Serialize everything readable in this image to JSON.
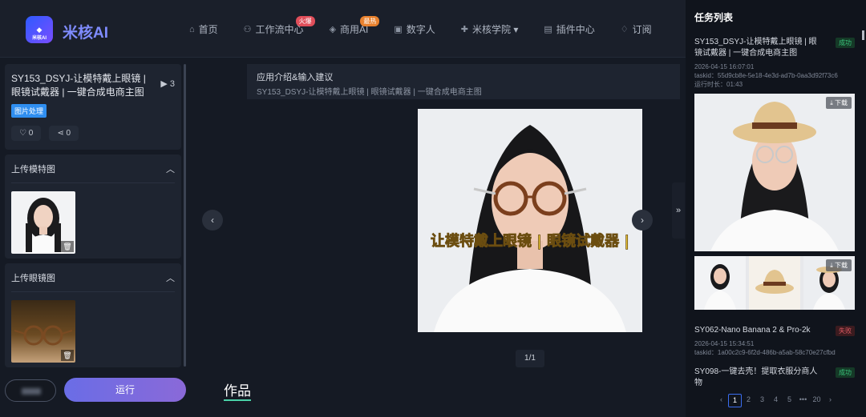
{
  "app": {
    "name": "米核AI",
    "logo_sub": "米核AI"
  },
  "nav": {
    "items": [
      {
        "icon": "home-icon",
        "glyph": "⌂",
        "label": "首页"
      },
      {
        "icon": "workflow-icon",
        "glyph": "⚇",
        "label": "工作流中心",
        "badge": "火爆"
      },
      {
        "icon": "commercial-icon",
        "glyph": "◈",
        "label": "商用AI",
        "badge": "最热"
      },
      {
        "icon": "digital-human-icon",
        "glyph": "▣",
        "label": "数字人"
      },
      {
        "icon": "academy-icon",
        "glyph": "✚",
        "label": "米核学院 ▾"
      },
      {
        "icon": "plugin-icon",
        "glyph": "▤",
        "label": "插件中心"
      },
      {
        "icon": "subscribe-icon",
        "glyph": "♢",
        "label": "订阅"
      }
    ]
  },
  "workflow": {
    "title": "SY153_DSYJ-让模特戴上眼镜 | 眼镜试戴器 | 一键合成电商主图",
    "count": "3",
    "tag": "图片处理",
    "likes": "0",
    "shares": "0"
  },
  "sections": {
    "model_upload": "上传模特图",
    "glasses_upload": "上传眼镜图"
  },
  "buttons": {
    "run": "运行"
  },
  "info": {
    "heading": "应用介绍&输入建议",
    "desc": "SY153_DSYJ-让模特戴上眼镜 | 眼镜试戴器 | 一键合成电商主图"
  },
  "preview": {
    "overlay_text": "让模特戴上眼镜 | 眼镜试戴器 |",
    "pager": "1/1"
  },
  "works_title": "作品",
  "tasks": {
    "title": "任务列表",
    "download_label": "下载",
    "items": [
      {
        "name": "SY153_DSYJ-让模特戴上眼镜 | 眼镜试戴器 | 一键合成电商主图",
        "status": "成功",
        "time": "2026-04-15 16:07:01",
        "taskid": "taskid：55d9cb8e-5e18-4e3d-ad7b-0aa3d92f73c6",
        "runtime": "运行时长：01:43"
      },
      {
        "name": "SY062-Nano Banana 2 & Pro-2k",
        "status": "失败",
        "time": "2026-04-15 15:34:51",
        "taskid": "taskid：1a00c2c9-6f2d-486b-a5ab-58c70e27cfbd"
      },
      {
        "name": "SY098-一键去壳！提取衣服分商人物",
        "status": "成功"
      }
    ],
    "pagination": [
      "‹",
      "1",
      "2",
      "3",
      "4",
      "5",
      "•••",
      "20",
      "›"
    ]
  },
  "colors": {
    "accent": "#6a6de6",
    "success": "#39c27a",
    "fail": "#e05b64",
    "link": "#3a6df0"
  }
}
